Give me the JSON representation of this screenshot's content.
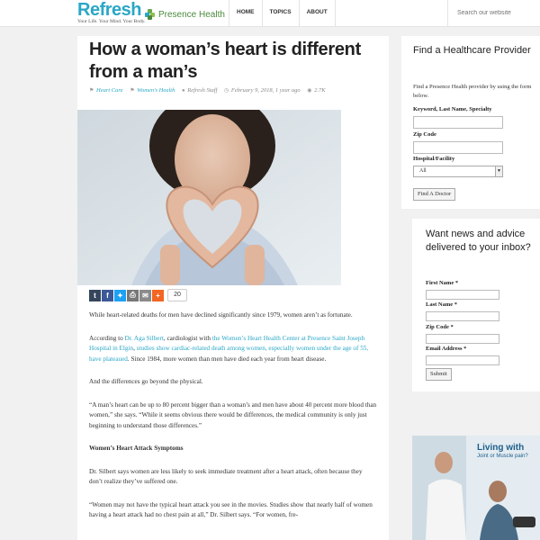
{
  "header": {
    "logo": "Refresh",
    "tagline": "Your Life. Your Mind. Your Body.",
    "partner": "Presence Health",
    "nav": [
      "HOME",
      "TOPICS",
      "ABOUT"
    ],
    "search_placeholder": "Search our website",
    "accent": "#2aa7c6"
  },
  "article": {
    "title": "How a woman’s heart is different from a man’s",
    "meta": {
      "category1": "Heart Care",
      "category2": "Women's Health",
      "author": "Refresh Staff",
      "date": "February 9, 2018, 1 year ago",
      "views": "2.7K"
    },
    "share": {
      "icons": [
        "tumblr-icon",
        "facebook-icon",
        "twitter-icon",
        "print-icon",
        "email-icon",
        "more-icon"
      ],
      "count": "20"
    },
    "p1": "While heart-related deaths for men have declined significantly since 1979, women aren’t as fortunate.",
    "p2_pre": "According to ",
    "p2_link1": "Dr. Aga Silbert",
    "p2_mid": ", cardiologist with ",
    "p2_link2": "the Women’s Heart Health Center at Presence Saint Joseph Hospital in Elgin",
    "p2_comma": ", ",
    "p2_link3": "studies show cardiac-related death among women, especially women under the age of 55, have plateaued",
    "p2_post": ". Since 1984, more women than men have died each year from heart disease.",
    "p3": "And the differences go beyond the physical.",
    "p4": "“A man’s heart can be up to 80 percent bigger than a woman’s and men have about 40 percent more blood than women,” she says. “While it seems obvious there would be differences, the medical community is only just beginning to understand those differences.”",
    "h1": "Women’s Heart Attack Symptoms",
    "p5": "Dr. Silbert says women are less likely to seek immediate treatment after a heart attack, often because they don’t realize they’ve suffered one.",
    "p6": "“Women may not have the typical heart attack you see in the movies. Studies show that nearly half of women having a heart attack had no chest pain at all,” Dr. Silbert says. “For women, fre-"
  },
  "provider_widget": {
    "title": "Find a Healthcare Provider",
    "desc": "Find a Presence Health provider by using the form below.",
    "label_keyword": "Keyword, Last Name, Specialty",
    "label_zip": "Zip Code",
    "label_hospital": "Hospital/Facility",
    "hospital_value": "All",
    "button": "Find A Doctor"
  },
  "news_widget": {
    "title": "Want news and advice delivered to your inbox?",
    "label_first": "First Name *",
    "label_last": "Last Name *",
    "label_zip": "Zip Code *",
    "label_email": "Email Address *",
    "button": "Submit"
  },
  "ad": {
    "title": "Living with",
    "subtitle": "Joint or Muscle pain?"
  }
}
